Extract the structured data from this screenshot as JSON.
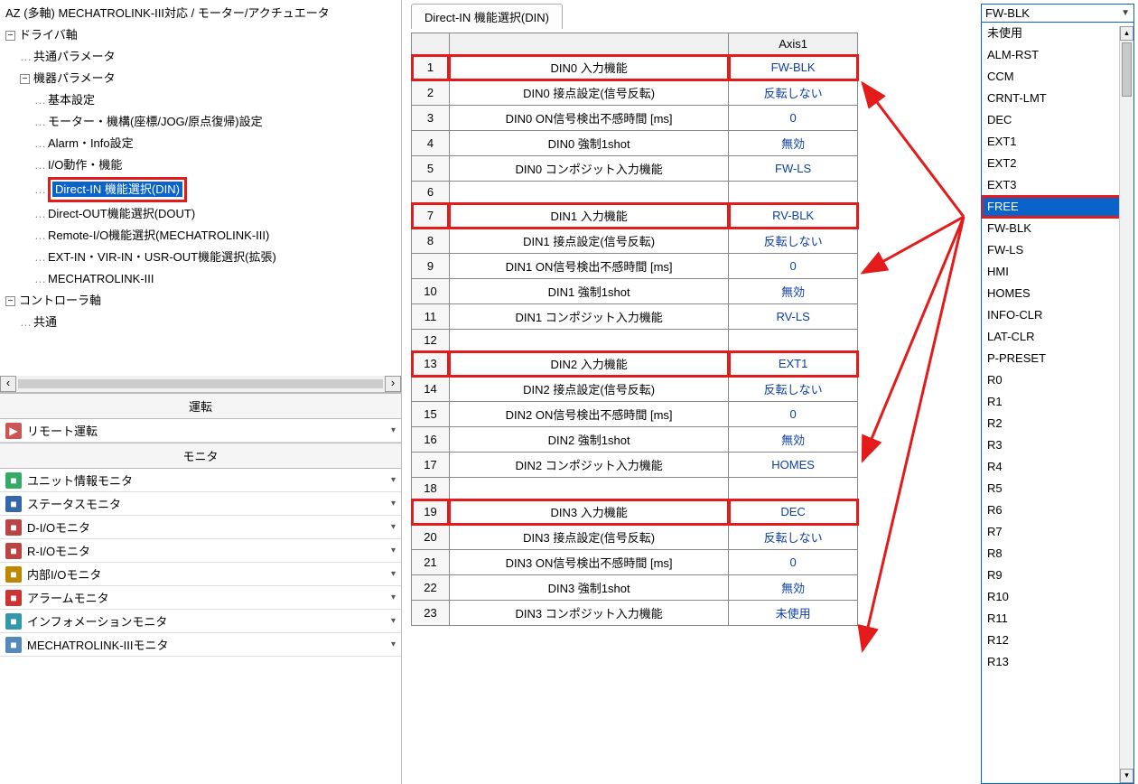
{
  "tree": {
    "root": "AZ (多軸) MECHATROLINK-III対応 / モーター/アクチュエータ",
    "driver": "ドライバ軸",
    "common_param": "共通パラメータ",
    "device_param": "機器パラメータ",
    "items": [
      "基本設定",
      "モーター・機構(座標/JOG/原点復帰)設定",
      "Alarm・Info設定",
      "I/O動作・機能",
      "Direct-IN 機能選択(DIN)",
      "Direct-OUT機能選択(DOUT)",
      "Remote-I/O機能選択(MECHATROLINK-III)",
      "EXT-IN・VIR-IN・USR-OUT機能選択(拡張)",
      "MECHATROLINK-III"
    ],
    "controller": "コントローラ軸",
    "controller_common": "共通"
  },
  "panels": {
    "operation": "運転",
    "remote_op": "リモート運転",
    "monitor": "モニタ",
    "monitors": [
      "ユニット情報モニタ",
      "ステータスモニタ",
      "D-I/Oモニタ",
      "R-I/Oモニタ",
      "内部I/Oモニタ",
      "アラームモニタ",
      "インフォメーションモニタ",
      "MECHATROLINK-IIIモニタ"
    ]
  },
  "tab_title": "Direct-IN 機能選択(DIN)",
  "grid": {
    "header_axis": "Axis1",
    "rows": [
      {
        "n": "1",
        "d": "DIN0 入力機能",
        "v": "FW-BLK",
        "hl": true
      },
      {
        "n": "2",
        "d": "DIN0 接点設定(信号反転)",
        "v": "反転しない"
      },
      {
        "n": "3",
        "d": "DIN0 ON信号検出不感時間 [ms]",
        "v": "0"
      },
      {
        "n": "4",
        "d": "DIN0 強制1shot",
        "v": "無効"
      },
      {
        "n": "5",
        "d": "DIN0 コンポジット入力機能",
        "v": "FW-LS"
      },
      {
        "n": "6",
        "d": "",
        "v": ""
      },
      {
        "n": "7",
        "d": "DIN1 入力機能",
        "v": "RV-BLK",
        "hl": true
      },
      {
        "n": "8",
        "d": "DIN1 接点設定(信号反転)",
        "v": "反転しない"
      },
      {
        "n": "9",
        "d": "DIN1 ON信号検出不感時間 [ms]",
        "v": "0"
      },
      {
        "n": "10",
        "d": "DIN1 強制1shot",
        "v": "無効"
      },
      {
        "n": "11",
        "d": "DIN1 コンポジット入力機能",
        "v": "RV-LS"
      },
      {
        "n": "12",
        "d": "",
        "v": ""
      },
      {
        "n": "13",
        "d": "DIN2 入力機能",
        "v": "EXT1",
        "hl": true
      },
      {
        "n": "14",
        "d": "DIN2 接点設定(信号反転)",
        "v": "反転しない"
      },
      {
        "n": "15",
        "d": "DIN2 ON信号検出不感時間 [ms]",
        "v": "0"
      },
      {
        "n": "16",
        "d": "DIN2 強制1shot",
        "v": "無効"
      },
      {
        "n": "17",
        "d": "DIN2 コンポジット入力機能",
        "v": "HOMES"
      },
      {
        "n": "18",
        "d": "",
        "v": ""
      },
      {
        "n": "19",
        "d": "DIN3 入力機能",
        "v": "DEC",
        "hl": true
      },
      {
        "n": "20",
        "d": "DIN3 接点設定(信号反転)",
        "v": "反転しない"
      },
      {
        "n": "21",
        "d": "DIN3 ON信号検出不感時間 [ms]",
        "v": "0"
      },
      {
        "n": "22",
        "d": "DIN3 強制1shot",
        "v": "無効"
      },
      {
        "n": "23",
        "d": "DIN3 コンポジット入力機能",
        "v": "未使用"
      }
    ]
  },
  "dropdown": {
    "current": "FW-BLK",
    "options": [
      "未使用",
      "ALM-RST",
      "CCM",
      "CRNT-LMT",
      "DEC",
      "EXT1",
      "EXT2",
      "EXT3",
      "FREE",
      "FW-BLK",
      "FW-LS",
      "HMI",
      "HOMES",
      "INFO-CLR",
      "LAT-CLR",
      "P-PRESET",
      "R0",
      "R1",
      "R2",
      "R3",
      "R4",
      "R5",
      "R6",
      "R7",
      "R8",
      "R9",
      "R10",
      "R11",
      "R12",
      "R13"
    ],
    "selected": "FREE"
  },
  "icon_colors": [
    "#3a6",
    "#36a",
    "#b44",
    "#b44",
    "#b80",
    "#c33",
    "#39a",
    "#58b"
  ]
}
